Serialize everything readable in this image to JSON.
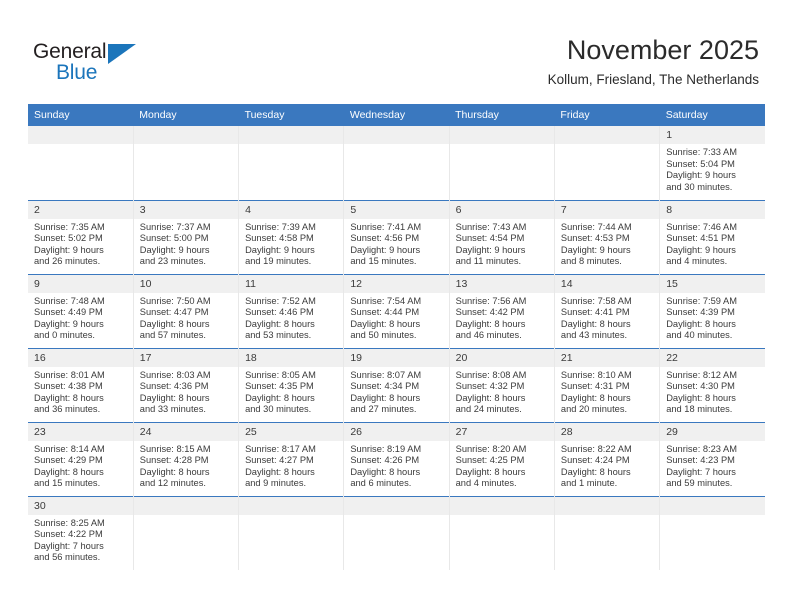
{
  "brand": {
    "name_part1": "General",
    "name_part2": "Blue",
    "triangle_icon": "blue-triangle-icon",
    "color_dark": "#231f20",
    "color_blue": "#1b75bb"
  },
  "header": {
    "title": "November 2025",
    "subtitle": "Kollum, Friesland, The Netherlands"
  },
  "theme": {
    "header_bg": "#3a78bf",
    "header_text": "#ffffff",
    "daynum_bg": "#f0f0f0",
    "row_separator": "#3a78bf",
    "body_text": "#3b3b3b"
  },
  "weekdays": [
    "Sunday",
    "Monday",
    "Tuesday",
    "Wednesday",
    "Thursday",
    "Friday",
    "Saturday"
  ],
  "weeks": [
    [
      {
        "day": "",
        "empty": true,
        "sunrise": "",
        "sunset": "",
        "daylight1": "",
        "daylight2": ""
      },
      {
        "day": "",
        "empty": true,
        "sunrise": "",
        "sunset": "",
        "daylight1": "",
        "daylight2": ""
      },
      {
        "day": "",
        "empty": true,
        "sunrise": "",
        "sunset": "",
        "daylight1": "",
        "daylight2": ""
      },
      {
        "day": "",
        "empty": true,
        "sunrise": "",
        "sunset": "",
        "daylight1": "",
        "daylight2": ""
      },
      {
        "day": "",
        "empty": true,
        "sunrise": "",
        "sunset": "",
        "daylight1": "",
        "daylight2": ""
      },
      {
        "day": "",
        "empty": true,
        "sunrise": "",
        "sunset": "",
        "daylight1": "",
        "daylight2": ""
      },
      {
        "day": "1",
        "empty": false,
        "sunrise": "Sunrise: 7:33 AM",
        "sunset": "Sunset: 5:04 PM",
        "daylight1": "Daylight: 9 hours",
        "daylight2": "and 30 minutes."
      }
    ],
    [
      {
        "day": "2",
        "empty": false,
        "sunrise": "Sunrise: 7:35 AM",
        "sunset": "Sunset: 5:02 PM",
        "daylight1": "Daylight: 9 hours",
        "daylight2": "and 26 minutes."
      },
      {
        "day": "3",
        "empty": false,
        "sunrise": "Sunrise: 7:37 AM",
        "sunset": "Sunset: 5:00 PM",
        "daylight1": "Daylight: 9 hours",
        "daylight2": "and 23 minutes."
      },
      {
        "day": "4",
        "empty": false,
        "sunrise": "Sunrise: 7:39 AM",
        "sunset": "Sunset: 4:58 PM",
        "daylight1": "Daylight: 9 hours",
        "daylight2": "and 19 minutes."
      },
      {
        "day": "5",
        "empty": false,
        "sunrise": "Sunrise: 7:41 AM",
        "sunset": "Sunset: 4:56 PM",
        "daylight1": "Daylight: 9 hours",
        "daylight2": "and 15 minutes."
      },
      {
        "day": "6",
        "empty": false,
        "sunrise": "Sunrise: 7:43 AM",
        "sunset": "Sunset: 4:54 PM",
        "daylight1": "Daylight: 9 hours",
        "daylight2": "and 11 minutes."
      },
      {
        "day": "7",
        "empty": false,
        "sunrise": "Sunrise: 7:44 AM",
        "sunset": "Sunset: 4:53 PM",
        "daylight1": "Daylight: 9 hours",
        "daylight2": "and 8 minutes."
      },
      {
        "day": "8",
        "empty": false,
        "sunrise": "Sunrise: 7:46 AM",
        "sunset": "Sunset: 4:51 PM",
        "daylight1": "Daylight: 9 hours",
        "daylight2": "and 4 minutes."
      }
    ],
    [
      {
        "day": "9",
        "empty": false,
        "sunrise": "Sunrise: 7:48 AM",
        "sunset": "Sunset: 4:49 PM",
        "daylight1": "Daylight: 9 hours",
        "daylight2": "and 0 minutes."
      },
      {
        "day": "10",
        "empty": false,
        "sunrise": "Sunrise: 7:50 AM",
        "sunset": "Sunset: 4:47 PM",
        "daylight1": "Daylight: 8 hours",
        "daylight2": "and 57 minutes."
      },
      {
        "day": "11",
        "empty": false,
        "sunrise": "Sunrise: 7:52 AM",
        "sunset": "Sunset: 4:46 PM",
        "daylight1": "Daylight: 8 hours",
        "daylight2": "and 53 minutes."
      },
      {
        "day": "12",
        "empty": false,
        "sunrise": "Sunrise: 7:54 AM",
        "sunset": "Sunset: 4:44 PM",
        "daylight1": "Daylight: 8 hours",
        "daylight2": "and 50 minutes."
      },
      {
        "day": "13",
        "empty": false,
        "sunrise": "Sunrise: 7:56 AM",
        "sunset": "Sunset: 4:42 PM",
        "daylight1": "Daylight: 8 hours",
        "daylight2": "and 46 minutes."
      },
      {
        "day": "14",
        "empty": false,
        "sunrise": "Sunrise: 7:58 AM",
        "sunset": "Sunset: 4:41 PM",
        "daylight1": "Daylight: 8 hours",
        "daylight2": "and 43 minutes."
      },
      {
        "day": "15",
        "empty": false,
        "sunrise": "Sunrise: 7:59 AM",
        "sunset": "Sunset: 4:39 PM",
        "daylight1": "Daylight: 8 hours",
        "daylight2": "and 40 minutes."
      }
    ],
    [
      {
        "day": "16",
        "empty": false,
        "sunrise": "Sunrise: 8:01 AM",
        "sunset": "Sunset: 4:38 PM",
        "daylight1": "Daylight: 8 hours",
        "daylight2": "and 36 minutes."
      },
      {
        "day": "17",
        "empty": false,
        "sunrise": "Sunrise: 8:03 AM",
        "sunset": "Sunset: 4:36 PM",
        "daylight1": "Daylight: 8 hours",
        "daylight2": "and 33 minutes."
      },
      {
        "day": "18",
        "empty": false,
        "sunrise": "Sunrise: 8:05 AM",
        "sunset": "Sunset: 4:35 PM",
        "daylight1": "Daylight: 8 hours",
        "daylight2": "and 30 minutes."
      },
      {
        "day": "19",
        "empty": false,
        "sunrise": "Sunrise: 8:07 AM",
        "sunset": "Sunset: 4:34 PM",
        "daylight1": "Daylight: 8 hours",
        "daylight2": "and 27 minutes."
      },
      {
        "day": "20",
        "empty": false,
        "sunrise": "Sunrise: 8:08 AM",
        "sunset": "Sunset: 4:32 PM",
        "daylight1": "Daylight: 8 hours",
        "daylight2": "and 24 minutes."
      },
      {
        "day": "21",
        "empty": false,
        "sunrise": "Sunrise: 8:10 AM",
        "sunset": "Sunset: 4:31 PM",
        "daylight1": "Daylight: 8 hours",
        "daylight2": "and 20 minutes."
      },
      {
        "day": "22",
        "empty": false,
        "sunrise": "Sunrise: 8:12 AM",
        "sunset": "Sunset: 4:30 PM",
        "daylight1": "Daylight: 8 hours",
        "daylight2": "and 18 minutes."
      }
    ],
    [
      {
        "day": "23",
        "empty": false,
        "sunrise": "Sunrise: 8:14 AM",
        "sunset": "Sunset: 4:29 PM",
        "daylight1": "Daylight: 8 hours",
        "daylight2": "and 15 minutes."
      },
      {
        "day": "24",
        "empty": false,
        "sunrise": "Sunrise: 8:15 AM",
        "sunset": "Sunset: 4:28 PM",
        "daylight1": "Daylight: 8 hours",
        "daylight2": "and 12 minutes."
      },
      {
        "day": "25",
        "empty": false,
        "sunrise": "Sunrise: 8:17 AM",
        "sunset": "Sunset: 4:27 PM",
        "daylight1": "Daylight: 8 hours",
        "daylight2": "and 9 minutes."
      },
      {
        "day": "26",
        "empty": false,
        "sunrise": "Sunrise: 8:19 AM",
        "sunset": "Sunset: 4:26 PM",
        "daylight1": "Daylight: 8 hours",
        "daylight2": "and 6 minutes."
      },
      {
        "day": "27",
        "empty": false,
        "sunrise": "Sunrise: 8:20 AM",
        "sunset": "Sunset: 4:25 PM",
        "daylight1": "Daylight: 8 hours",
        "daylight2": "and 4 minutes."
      },
      {
        "day": "28",
        "empty": false,
        "sunrise": "Sunrise: 8:22 AM",
        "sunset": "Sunset: 4:24 PM",
        "daylight1": "Daylight: 8 hours",
        "daylight2": "and 1 minute."
      },
      {
        "day": "29",
        "empty": false,
        "sunrise": "Sunrise: 8:23 AM",
        "sunset": "Sunset: 4:23 PM",
        "daylight1": "Daylight: 7 hours",
        "daylight2": "and 59 minutes."
      }
    ],
    [
      {
        "day": "30",
        "empty": false,
        "sunrise": "Sunrise: 8:25 AM",
        "sunset": "Sunset: 4:22 PM",
        "daylight1": "Daylight: 7 hours",
        "daylight2": "and 56 minutes."
      },
      {
        "day": "",
        "empty": true,
        "sunrise": "",
        "sunset": "",
        "daylight1": "",
        "daylight2": ""
      },
      {
        "day": "",
        "empty": true,
        "sunrise": "",
        "sunset": "",
        "daylight1": "",
        "daylight2": ""
      },
      {
        "day": "",
        "empty": true,
        "sunrise": "",
        "sunset": "",
        "daylight1": "",
        "daylight2": ""
      },
      {
        "day": "",
        "empty": true,
        "sunrise": "",
        "sunset": "",
        "daylight1": "",
        "daylight2": ""
      },
      {
        "day": "",
        "empty": true,
        "sunrise": "",
        "sunset": "",
        "daylight1": "",
        "daylight2": ""
      },
      {
        "day": "",
        "empty": true,
        "sunrise": "",
        "sunset": "",
        "daylight1": "",
        "daylight2": ""
      }
    ]
  ]
}
